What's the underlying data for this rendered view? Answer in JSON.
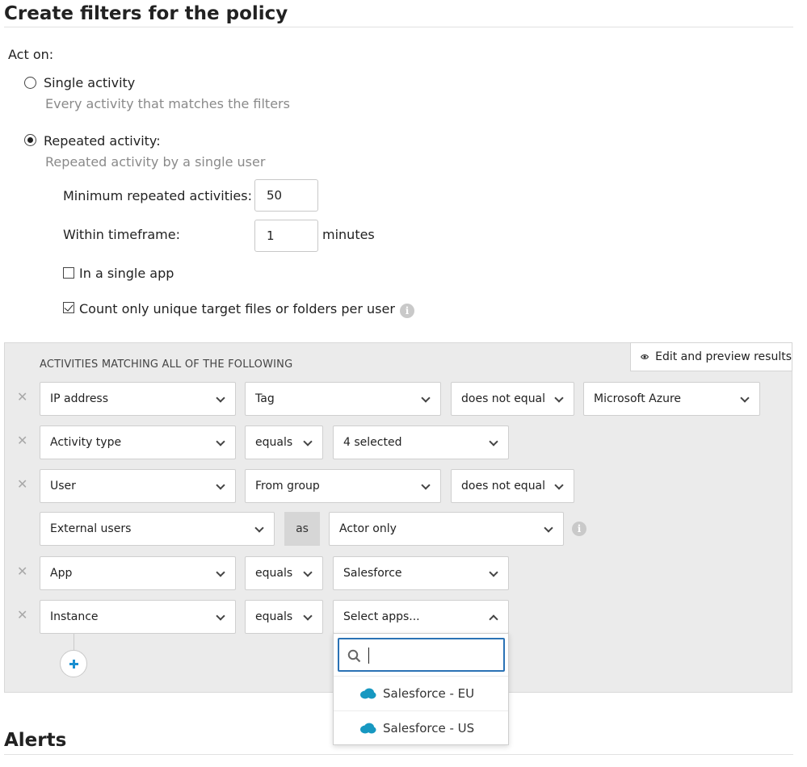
{
  "section_title": "Create filters for the policy",
  "act_on": {
    "label": "Act on:",
    "single": {
      "label": "Single activity",
      "description": "Every activity that matches the filters",
      "checked": false
    },
    "repeated": {
      "label": "Repeated activity:",
      "description": "Repeated activity by a single user",
      "checked": true
    },
    "min_repeated": {
      "label": "Minimum repeated activities:",
      "value": "50"
    },
    "timeframe": {
      "label": "Within timeframe:",
      "value": "1",
      "unit": "minutes"
    },
    "single_app": {
      "label": "In a single app",
      "checked": false
    },
    "unique_targets": {
      "label": "Count only unique target files or folders per user",
      "checked": true
    }
  },
  "filters": {
    "heading": "ACTIVITIES MATCHING ALL OF THE FOLLOWING",
    "preview_button": "Edit and preview results",
    "rows": [
      {
        "field": "IP address",
        "operator": "Tag",
        "qualifier": "does not equal",
        "value": "Microsoft Azure"
      },
      {
        "field": "Activity type",
        "operator": "equals",
        "value": "4 selected"
      },
      {
        "field": "User",
        "operator": "From group",
        "qualifier": "does not equal"
      },
      {
        "field": "External users",
        "connector": "as",
        "value": "Actor only"
      },
      {
        "field": "App",
        "operator": "equals",
        "value": "Salesforce"
      },
      {
        "field": "Instance",
        "operator": "equals",
        "value": "Select apps..."
      }
    ],
    "instance_dropdown": {
      "search_placeholder": "",
      "options": [
        "Salesforce - EU",
        "Salesforce - US"
      ]
    }
  },
  "alerts_title": "Alerts",
  "colors": {
    "accent": "#2a72b5",
    "plus": "#1a8fd1",
    "salesforce": "#1798c1"
  }
}
